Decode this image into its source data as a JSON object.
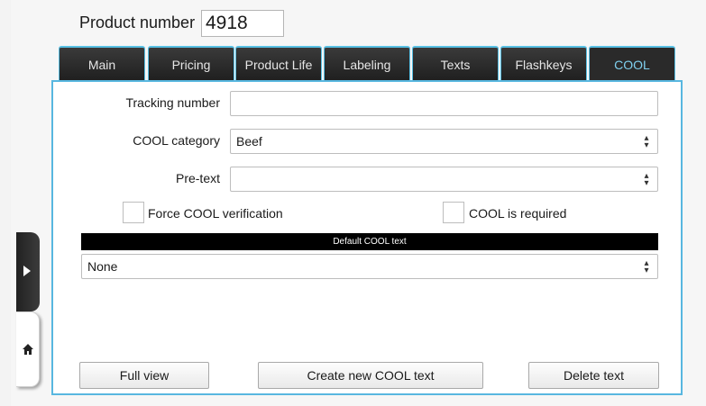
{
  "header": {
    "product_number_label": "Product number",
    "product_number_value": "4918"
  },
  "tabs": [
    {
      "label": "Main"
    },
    {
      "label": "Pricing"
    },
    {
      "label": "Product Life"
    },
    {
      "label": "Labeling"
    },
    {
      "label": "Texts"
    },
    {
      "label": "Flashkeys"
    },
    {
      "label": "COOL",
      "active": true
    }
  ],
  "form": {
    "tracking_number_label": "Tracking number",
    "tracking_number_value": "",
    "cool_category_label": "COOL category",
    "cool_category_value": "Beef",
    "pretext_label": "Pre-text",
    "pretext_value": "",
    "force_verification_label": "Force COOL verification",
    "force_verification_checked": false,
    "cool_required_label": "COOL is required",
    "cool_required_checked": false,
    "default_cool_text_header": "Default COOL text",
    "default_cool_text_value": "None"
  },
  "buttons": {
    "full_view": "Full view",
    "create_new": "Create new COOL text",
    "delete_text": "Delete text"
  },
  "colors": {
    "accent": "#58b7e0",
    "tab_bg": "#2a2a2a",
    "active_tab_text": "#7fd0ef"
  },
  "icons": {
    "expand": "chevron-right-icon",
    "home": "home-icon",
    "select_arrow": "updown-arrow-icon"
  }
}
